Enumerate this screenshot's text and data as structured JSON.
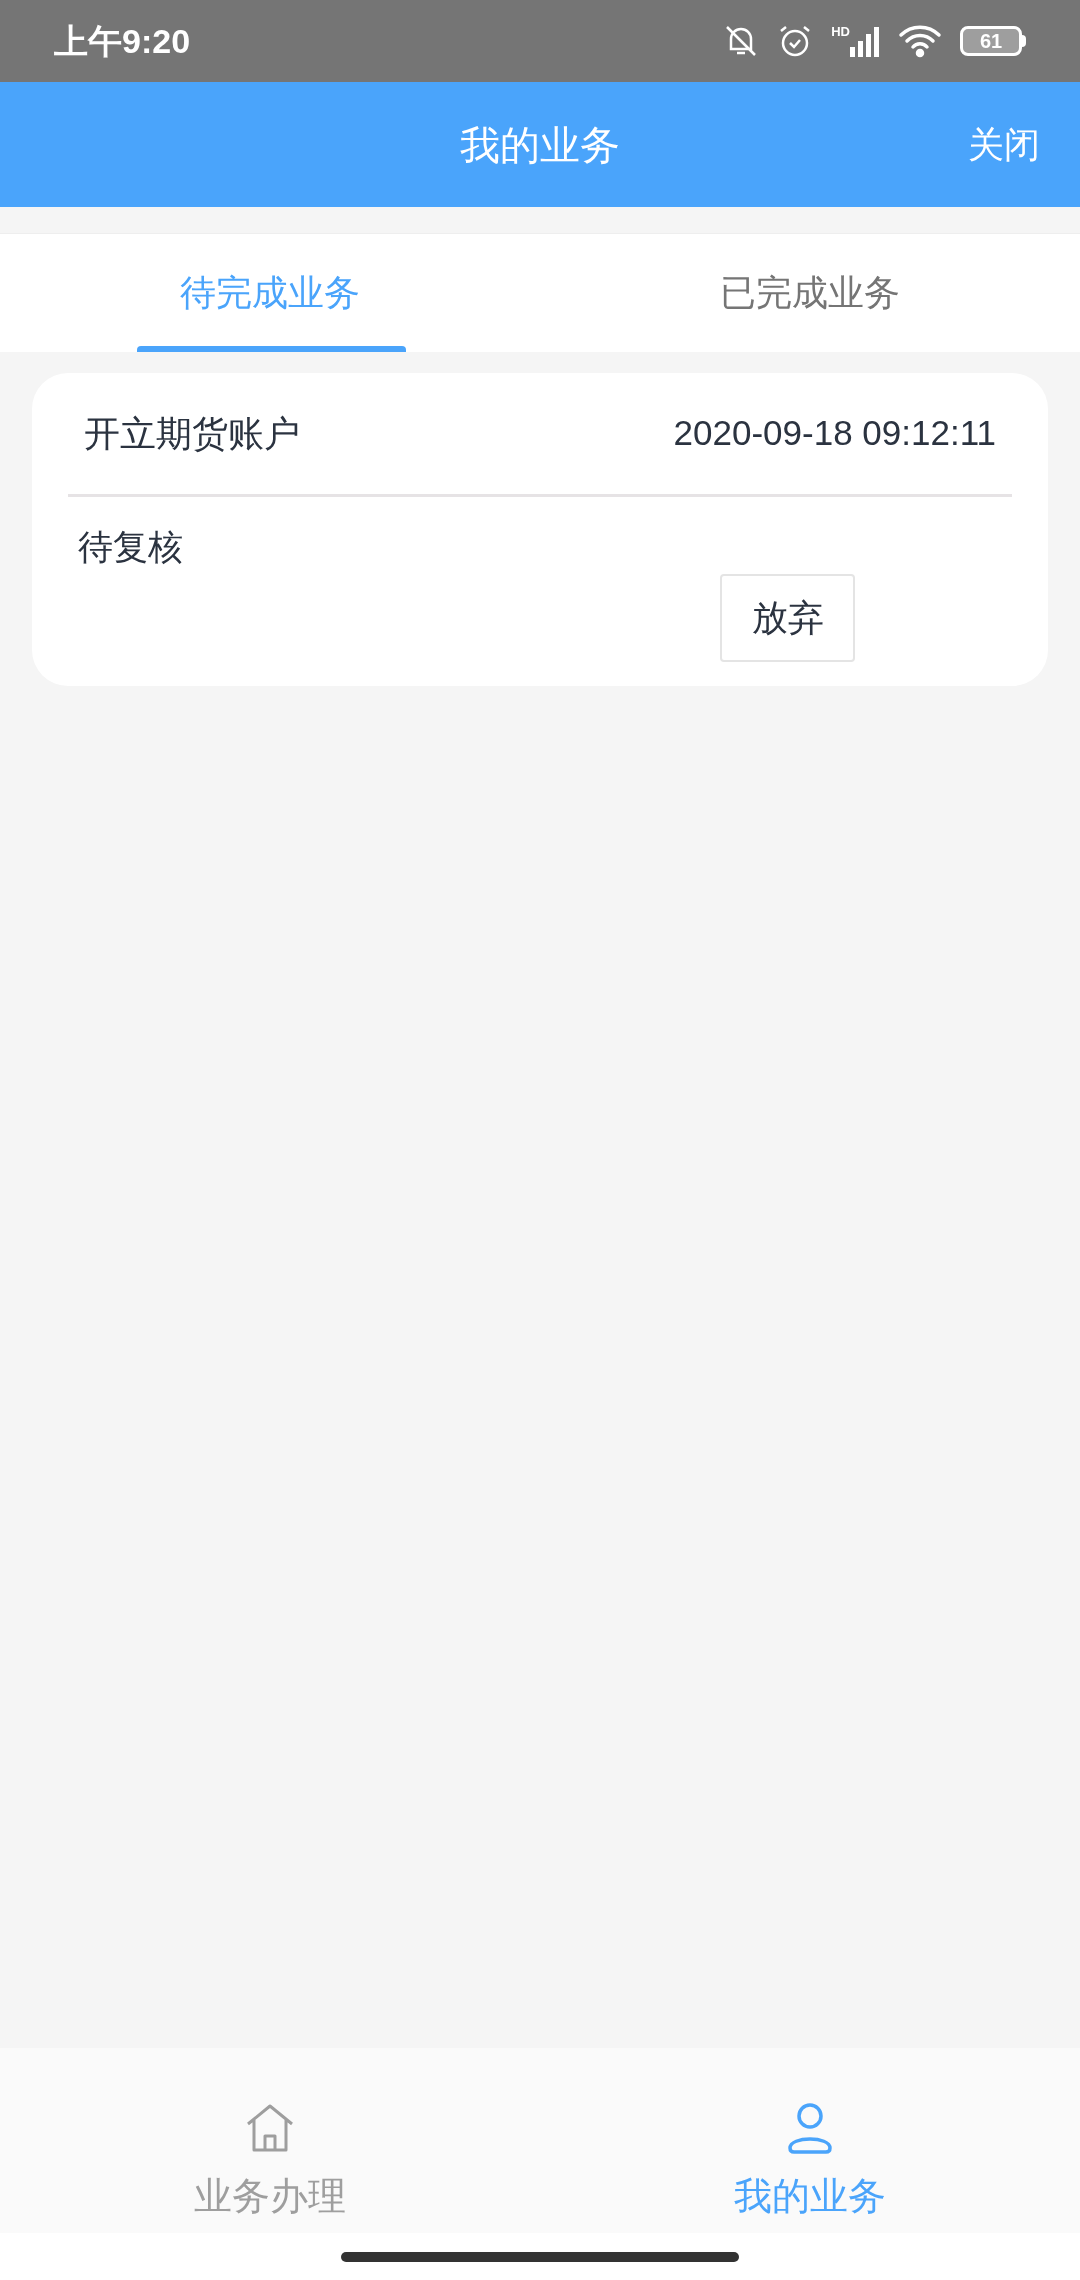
{
  "status_bar": {
    "time": "上午9:20",
    "network_label": "HD",
    "battery": "61"
  },
  "header": {
    "title": "我的业务",
    "close": "关闭"
  },
  "tabs": [
    {
      "label": "待完成业务",
      "selected": true
    },
    {
      "label": "已完成业务",
      "selected": false
    }
  ],
  "cards": [
    {
      "title": "开立期货账户",
      "time": "2020-09-18 09:12:11",
      "status": "待复核",
      "action": "放弃"
    }
  ],
  "bottom_nav": [
    {
      "label": "业务办理",
      "kind": "home",
      "selected": false
    },
    {
      "label": "我的业务",
      "kind": "user",
      "selected": true
    }
  ]
}
